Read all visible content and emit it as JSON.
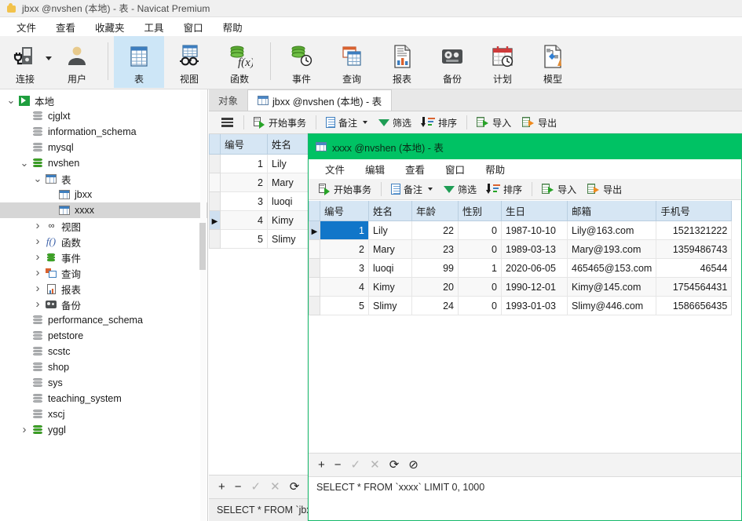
{
  "window": {
    "title": "jbxx @nvshen (本地) - 表 - Navicat Premium",
    "icon": "navicat-logo-icon"
  },
  "menubar": {
    "items": [
      {
        "label": "文件",
        "name": "menu-file"
      },
      {
        "label": "查看",
        "name": "menu-view"
      },
      {
        "label": "收藏夹",
        "name": "menu-favorites"
      },
      {
        "label": "工具",
        "name": "menu-tools"
      },
      {
        "label": "窗口",
        "name": "menu-window"
      },
      {
        "label": "帮助",
        "name": "menu-help"
      }
    ]
  },
  "toolbar": {
    "items": [
      {
        "label": "连接",
        "icon": "connection-icon",
        "active": false
      },
      {
        "label": "用户",
        "icon": "user-icon",
        "active": false
      },
      {
        "label": "表",
        "icon": "table-icon",
        "active": true
      },
      {
        "label": "视图",
        "icon": "view-icon",
        "active": false
      },
      {
        "label": "函数",
        "icon": "function-icon",
        "active": false
      },
      {
        "label": "事件",
        "icon": "event-icon",
        "active": false
      },
      {
        "label": "查询",
        "icon": "query-icon",
        "active": false
      },
      {
        "label": "报表",
        "icon": "report-icon",
        "active": false
      },
      {
        "label": "备份",
        "icon": "backup-icon",
        "active": false
      },
      {
        "label": "计划",
        "icon": "schedule-icon",
        "active": false
      },
      {
        "label": "模型",
        "icon": "model-icon",
        "active": false
      }
    ]
  },
  "sidebar": {
    "nodes": [
      {
        "label": "本地",
        "icon": "navicat-connection-icon",
        "indent": 0,
        "expander": "v",
        "selected": false
      },
      {
        "label": "cjglxt",
        "icon": "database-icon",
        "indent": 1,
        "expander": "",
        "selected": false
      },
      {
        "label": "information_schema",
        "icon": "database-icon",
        "indent": 1,
        "expander": "",
        "selected": false
      },
      {
        "label": "mysql",
        "icon": "database-icon",
        "indent": 1,
        "expander": "",
        "selected": false
      },
      {
        "label": "nvshen",
        "icon": "database-open-icon",
        "indent": 1,
        "expander": "v",
        "selected": false
      },
      {
        "label": "表",
        "icon": "tables-folder-icon",
        "indent": 2,
        "expander": "v",
        "selected": false
      },
      {
        "label": "jbxx",
        "icon": "table-item-icon",
        "indent": 3,
        "expander": "",
        "selected": false
      },
      {
        "label": "xxxx",
        "icon": "table-item-icon",
        "indent": 3,
        "expander": "",
        "selected": true
      },
      {
        "label": "视图",
        "icon": "views-folder-icon",
        "indent": 2,
        "expander": ">",
        "selected": false
      },
      {
        "label": "函数",
        "icon": "functions-folder-icon",
        "indent": 2,
        "expander": ">",
        "selected": false
      },
      {
        "label": "事件",
        "icon": "events-folder-icon",
        "indent": 2,
        "expander": ">",
        "selected": false
      },
      {
        "label": "查询",
        "icon": "queries-folder-icon",
        "indent": 2,
        "expander": ">",
        "selected": false
      },
      {
        "label": "报表",
        "icon": "reports-folder-icon",
        "indent": 2,
        "expander": ">",
        "selected": false
      },
      {
        "label": "备份",
        "icon": "backups-folder-icon",
        "indent": 2,
        "expander": ">",
        "selected": false
      },
      {
        "label": "performance_schema",
        "icon": "database-icon",
        "indent": 1,
        "expander": "",
        "selected": false
      },
      {
        "label": "petstore",
        "icon": "database-icon",
        "indent": 1,
        "expander": "",
        "selected": false
      },
      {
        "label": "scstc",
        "icon": "database-icon",
        "indent": 1,
        "expander": "",
        "selected": false
      },
      {
        "label": "shop",
        "icon": "database-icon",
        "indent": 1,
        "expander": "",
        "selected": false
      },
      {
        "label": "sys",
        "icon": "database-icon",
        "indent": 1,
        "expander": "",
        "selected": false
      },
      {
        "label": "teaching_system",
        "icon": "database-icon",
        "indent": 1,
        "expander": "",
        "selected": false
      },
      {
        "label": "xscj",
        "icon": "database-icon",
        "indent": 1,
        "expander": "",
        "selected": false
      },
      {
        "label": "yggl",
        "icon": "database-open-icon",
        "indent": 1,
        "expander": ">",
        "selected": false
      }
    ]
  },
  "main": {
    "tabs": [
      {
        "label": "对象",
        "icon": "",
        "active": false
      },
      {
        "label": "jbxx @nvshen (本地) - 表",
        "icon": "table-icon",
        "active": true
      }
    ],
    "grid_toolbar": [
      {
        "label": "开始事务",
        "icon": "begin-transaction-icon"
      },
      {
        "label": "备注",
        "icon": "note-icon",
        "caret": true
      },
      {
        "label": "筛选",
        "icon": "filter-icon"
      },
      {
        "label": "排序",
        "icon": "sort-icon"
      },
      {
        "label": "导入",
        "icon": "import-icon"
      },
      {
        "label": "导出",
        "icon": "export-icon"
      }
    ],
    "grid": {
      "columns": [
        "编号",
        "姓名"
      ],
      "rows": [
        {
          "cells": [
            "1",
            "Lily"
          ],
          "current": false
        },
        {
          "cells": [
            "2",
            "Mary"
          ],
          "current": false
        },
        {
          "cells": [
            "3",
            "luoqi"
          ],
          "current": false
        },
        {
          "cells": [
            "4",
            "Kimy"
          ],
          "current": true
        },
        {
          "cells": [
            "5",
            "Slimy"
          ],
          "current": false
        }
      ]
    },
    "record_nav": [
      {
        "icon": "add-record-icon",
        "label": "+",
        "dim": false
      },
      {
        "icon": "delete-record-icon",
        "label": "−",
        "dim": false
      },
      {
        "icon": "apply-change-icon",
        "label": "✓",
        "dim": true
      },
      {
        "icon": "cancel-change-icon",
        "label": "✕",
        "dim": true
      },
      {
        "icon": "refresh-icon",
        "label": "⟳",
        "dim": false
      },
      {
        "icon": "stop-icon",
        "label": "⊘",
        "dim": false
      }
    ],
    "status_sql": "SELECT * FROM `jbxx"
  },
  "floating_window": {
    "title": "xxxx @nvshen (本地) - 表",
    "title_icon": "table-icon",
    "accent_color": "#00c264",
    "menubar": [
      {
        "label": "文件",
        "name": "fw-menu-file"
      },
      {
        "label": "编辑",
        "name": "fw-menu-edit"
      },
      {
        "label": "查看",
        "name": "fw-menu-view"
      },
      {
        "label": "窗口",
        "name": "fw-menu-window"
      },
      {
        "label": "帮助",
        "name": "fw-menu-help"
      }
    ],
    "toolbar": [
      {
        "label": "开始事务",
        "icon": "begin-transaction-icon"
      },
      {
        "label": "备注",
        "icon": "note-icon",
        "caret": true
      },
      {
        "label": "筛选",
        "icon": "filter-icon"
      },
      {
        "label": "排序",
        "icon": "sort-icon"
      },
      {
        "label": "导入",
        "icon": "import-icon"
      },
      {
        "label": "导出",
        "icon": "export-icon"
      }
    ],
    "grid": {
      "columns": [
        "编号",
        "姓名",
        "年龄",
        "性别",
        "生日",
        "邮箱",
        "手机号"
      ],
      "rows": [
        {
          "cells": [
            "1",
            "Lily",
            "22",
            "0",
            "1987-10-10",
            "Lily@163.com",
            "1521321222"
          ],
          "current": true,
          "selected_cell": 0
        },
        {
          "cells": [
            "2",
            "Mary",
            "23",
            "0",
            "1989-03-13",
            "Mary@193.com",
            "1359486743"
          ],
          "current": false,
          "selected_cell": -1
        },
        {
          "cells": [
            "3",
            "luoqi",
            "99",
            "1",
            "2020-06-05",
            "465465@153.com",
            "46544"
          ],
          "current": false,
          "selected_cell": -1
        },
        {
          "cells": [
            "4",
            "Kimy",
            "20",
            "0",
            "1990-12-01",
            "Kimy@145.com",
            "1754564431"
          ],
          "current": false,
          "selected_cell": -1
        },
        {
          "cells": [
            "5",
            "Slimy",
            "24",
            "0",
            "1993-01-03",
            "Slimy@446.com",
            "1586656435"
          ],
          "current": false,
          "selected_cell": -1
        }
      ]
    },
    "record_nav": [
      {
        "icon": "add-record-icon",
        "label": "+",
        "dim": false
      },
      {
        "icon": "delete-record-icon",
        "label": "−",
        "dim": false
      },
      {
        "icon": "apply-change-icon",
        "label": "✓",
        "dim": true
      },
      {
        "icon": "cancel-change-icon",
        "label": "✕",
        "dim": true
      },
      {
        "icon": "refresh-icon",
        "label": "⟳",
        "dim": false
      },
      {
        "icon": "stop-icon",
        "label": "⊘",
        "dim": false
      }
    ],
    "status_sql": "SELECT * FROM `xxxx` LIMIT 0, 1000"
  }
}
